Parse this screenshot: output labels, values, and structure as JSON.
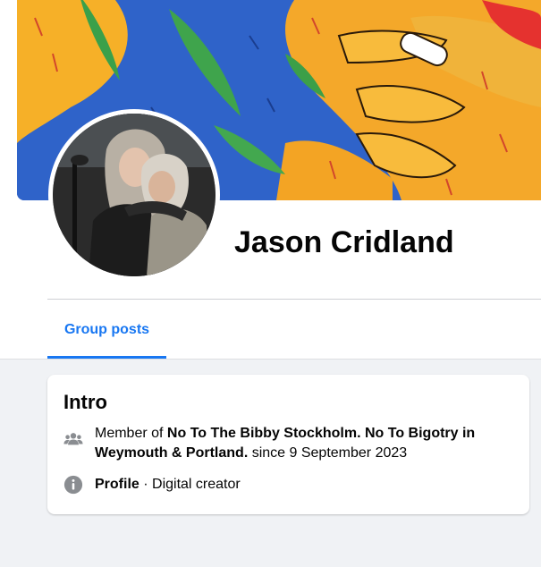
{
  "profile": {
    "name": "Jason Cridland"
  },
  "tabs": [
    {
      "label": "Group posts",
      "active": true
    }
  ],
  "intro": {
    "title": "Intro",
    "membership": {
      "prefix": "Member of ",
      "group_name": "No To The Bibby Stockholm. No To Bigotry in Weymouth & Portland.",
      "suffix": " since 9 September 2023",
      "icon": "people-icon"
    },
    "profile_type": {
      "label": "Profile",
      "separator": " · ",
      "category": "Digital creator",
      "icon": "info-icon"
    }
  },
  "colors": {
    "accent": "#1877f2",
    "text": "#050505",
    "secondary_text": "#65676b",
    "background": "#f0f2f5"
  }
}
